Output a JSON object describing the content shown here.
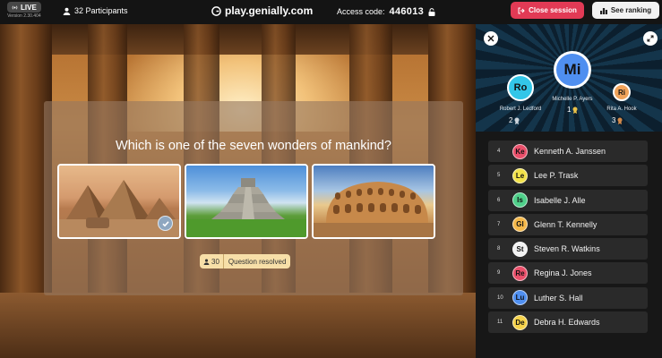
{
  "topbar": {
    "live_label": "LIVE",
    "version": "Version 2.30.404",
    "participants_label": "32 Participants",
    "url": "play.genially.com",
    "access_label": "Access code:",
    "access_code": "446013",
    "close_session_label": "Close session",
    "see_ranking_label": "See ranking"
  },
  "question": {
    "text": "Which is one of the seven wonders of mankind?",
    "answers": [
      {
        "image": "pyramids-of-giza",
        "correct": true
      },
      {
        "image": "chichen-itza",
        "correct": false
      },
      {
        "image": "colosseum",
        "correct": false
      }
    ],
    "responses_count": "30",
    "status_label": "Question resolved"
  },
  "podium": [
    {
      "rank": "1",
      "initials": "Mi",
      "name": "Michelle P. Ayers",
      "color": "#4f8ff0"
    },
    {
      "rank": "2",
      "initials": "Ro",
      "name": "Robert J. Ledford",
      "color": "#33c6e8"
    },
    {
      "rank": "3",
      "initials": "Ri",
      "name": "Rita A. Hook",
      "color": "#f0a35a"
    }
  ],
  "ranking": [
    {
      "rank": "4",
      "initials": "Ke",
      "name": "Kenneth A. Janssen",
      "color": "#e94f6a"
    },
    {
      "rank": "5",
      "initials": "Le",
      "name": "Lee P. Trask",
      "color": "#f2e24a"
    },
    {
      "rank": "6",
      "initials": "Is",
      "name": "Isabelle J. Alle",
      "color": "#4fd08a"
    },
    {
      "rank": "7",
      "initials": "Gl",
      "name": "Glenn T. Kennelly",
      "color": "#f5b84a"
    },
    {
      "rank": "8",
      "initials": "St",
      "name": "Steven R. Watkins",
      "color": "#f2f2f2"
    },
    {
      "rank": "9",
      "initials": "Re",
      "name": "Regina J. Jones",
      "color": "#e94f6a"
    },
    {
      "rank": "10",
      "initials": "Lu",
      "name": "Luther S. Hall",
      "color": "#4f8ff0"
    },
    {
      "rank": "11",
      "initials": "De",
      "name": "Debra H. Edwards",
      "color": "#f5d24a"
    }
  ],
  "icons": {
    "live": "broadcast-icon",
    "participants": "user-icon",
    "url": "genially-logo-icon",
    "access": "lock-icon",
    "close_session": "exit-icon",
    "see_ranking": "ranking-icon",
    "close_panel": "close-icon",
    "expand_panel": "expand-icon",
    "medal": "medal-icon",
    "correct": "check-icon"
  }
}
